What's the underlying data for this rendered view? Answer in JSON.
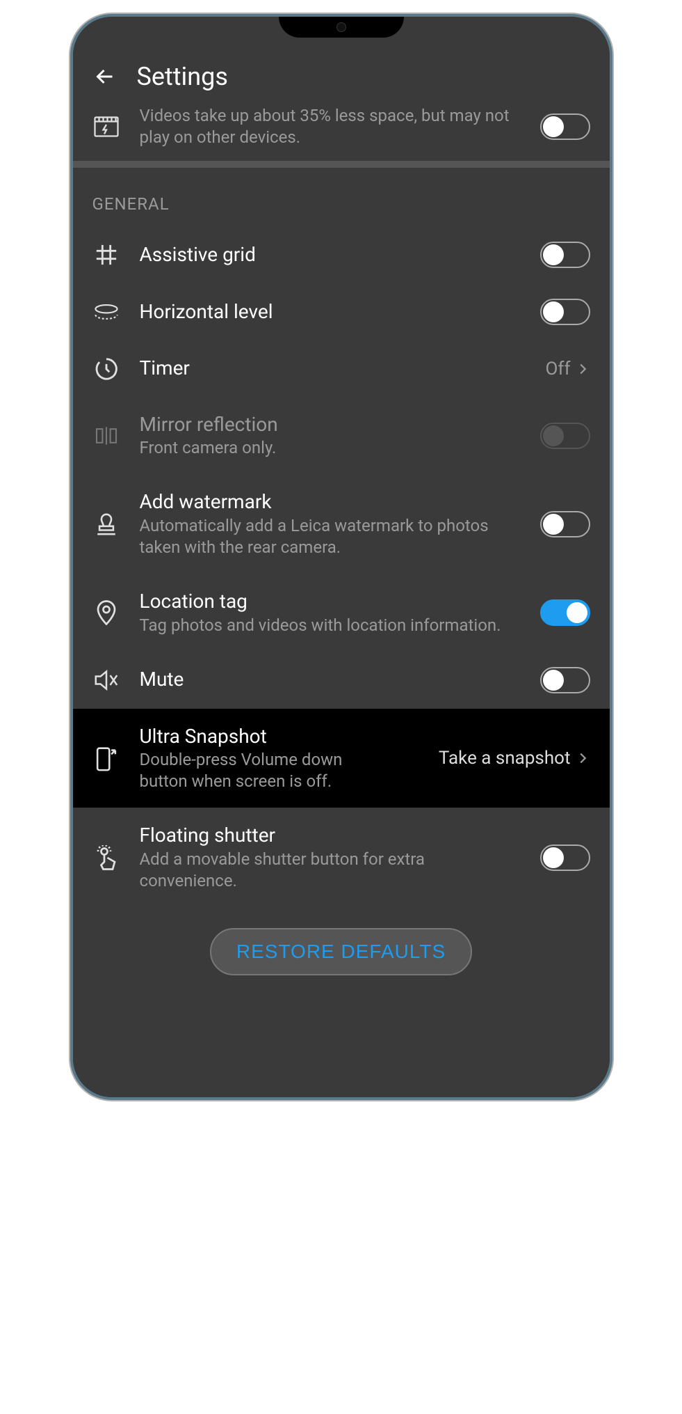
{
  "header": {
    "title": "Settings"
  },
  "topItem": {
    "subtitle": "Videos take up about 35% less space, but may not play on other devices.",
    "toggle": false
  },
  "sectionLabel": "GENERAL",
  "items": {
    "assistiveGrid": {
      "title": "Assistive grid",
      "toggle": false
    },
    "horizontalLevel": {
      "title": "Horizontal level",
      "toggle": false
    },
    "timer": {
      "title": "Timer",
      "value": "Off"
    },
    "mirror": {
      "title": "Mirror reflection",
      "subtitle": "Front camera only.",
      "toggle": false,
      "disabled": true
    },
    "watermark": {
      "title": "Add watermark",
      "subtitle": "Automatically add a Leica watermark to photos taken with the rear camera.",
      "toggle": false
    },
    "location": {
      "title": "Location tag",
      "subtitle": "Tag photos and videos with location information.",
      "toggle": true
    },
    "mute": {
      "title": "Mute",
      "toggle": false
    },
    "ultra": {
      "title": "Ultra Snapshot",
      "subtitle": "Double-press Volume down button when screen is off.",
      "value": "Take a snapshot"
    },
    "floating": {
      "title": "Floating shutter",
      "subtitle": "Add a movable shutter button for extra convenience.",
      "toggle": false
    }
  },
  "restoreLabel": "RESTORE DEFAULTS"
}
